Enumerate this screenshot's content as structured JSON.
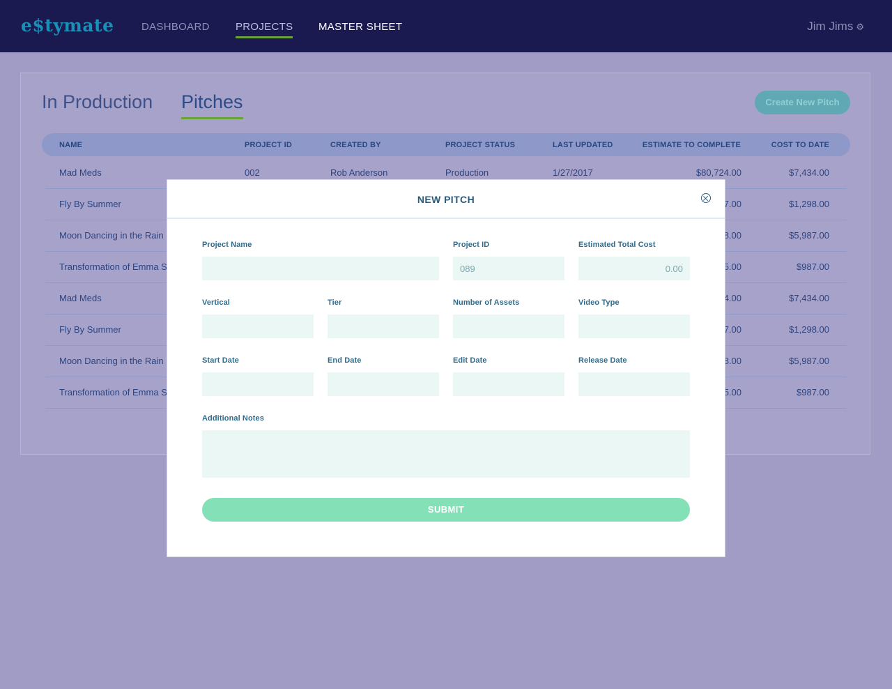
{
  "app": {
    "logo": "e$tymate"
  },
  "nav": {
    "items": [
      {
        "label": "DASHBOARD"
      },
      {
        "label": "PROJECTS"
      },
      {
        "label": "MASTER SHEET"
      }
    ],
    "active": "PROJECTS",
    "user": "Jim Jims",
    "user_icon": "gear-icon"
  },
  "tabs": [
    {
      "label": "In Production"
    },
    {
      "label": "Pitches"
    }
  ],
  "active_tab": "Pitches",
  "create_button": "Create New Pitch",
  "table": {
    "columns": [
      "NAME",
      "PROJECT ID",
      "CREATED BY",
      "PROJECT STATUS",
      "LAST UPDATED",
      "ESTIMATE TO COMPLETE",
      "COST TO DATE"
    ],
    "rows": [
      {
        "name": "Mad Meds",
        "project_id": "002",
        "created_by": "Rob Anderson",
        "status": "Production",
        "last_updated": "1/27/2017",
        "estimate": "$80,724.00",
        "cost": "$7,434.00"
      },
      {
        "name": "Fly By Summer",
        "estimate": "7.00",
        "cost": "$1,298.00"
      },
      {
        "name": "Moon Dancing in the Rain",
        "estimate": "8.00",
        "cost": "$5,987.00"
      },
      {
        "name": "Transformation of Emma S",
        "estimate": "5.00",
        "cost": "$987.00"
      },
      {
        "name": "Mad Meds",
        "estimate": "4.00",
        "cost": "$7,434.00"
      },
      {
        "name": "Fly By Summer",
        "estimate": "7.00",
        "cost": "$1,298.00"
      },
      {
        "name": "Moon Dancing in the Rain",
        "estimate": "8.00",
        "cost": "$5,987.00"
      },
      {
        "name": "Transformation of Emma S",
        "estimate": "5.00",
        "cost": "$987.00"
      }
    ]
  },
  "modal": {
    "title": "NEW PITCH",
    "fields": {
      "project_name": {
        "label": "Project Name",
        "value": ""
      },
      "project_id": {
        "label": "Project ID",
        "placeholder": "089"
      },
      "estimated_total_cost": {
        "label": "Estimated Total Cost",
        "placeholder": "0.00"
      },
      "vertical": {
        "label": "Vertical",
        "value": ""
      },
      "tier": {
        "label": "Tier",
        "value": ""
      },
      "number_of_assets": {
        "label": "Number of Assets",
        "value": ""
      },
      "video_type": {
        "label": "Video Type",
        "value": ""
      },
      "start_date": {
        "label": "Start Date",
        "value": ""
      },
      "end_date": {
        "label": "End Date",
        "value": ""
      },
      "edit_date": {
        "label": "Edit Date",
        "value": ""
      },
      "release_date": {
        "label": "Release Date",
        "value": ""
      },
      "additional_notes": {
        "label": "Additional Notes",
        "value": ""
      }
    },
    "submit_label": "SUBMIT"
  },
  "colors": {
    "nav_bg": "#1b1a50",
    "accent_green": "#6aa338",
    "submit_green": "#84e0b7",
    "input_bg": "#eaf7f4",
    "overlay": "#a19cc6"
  }
}
